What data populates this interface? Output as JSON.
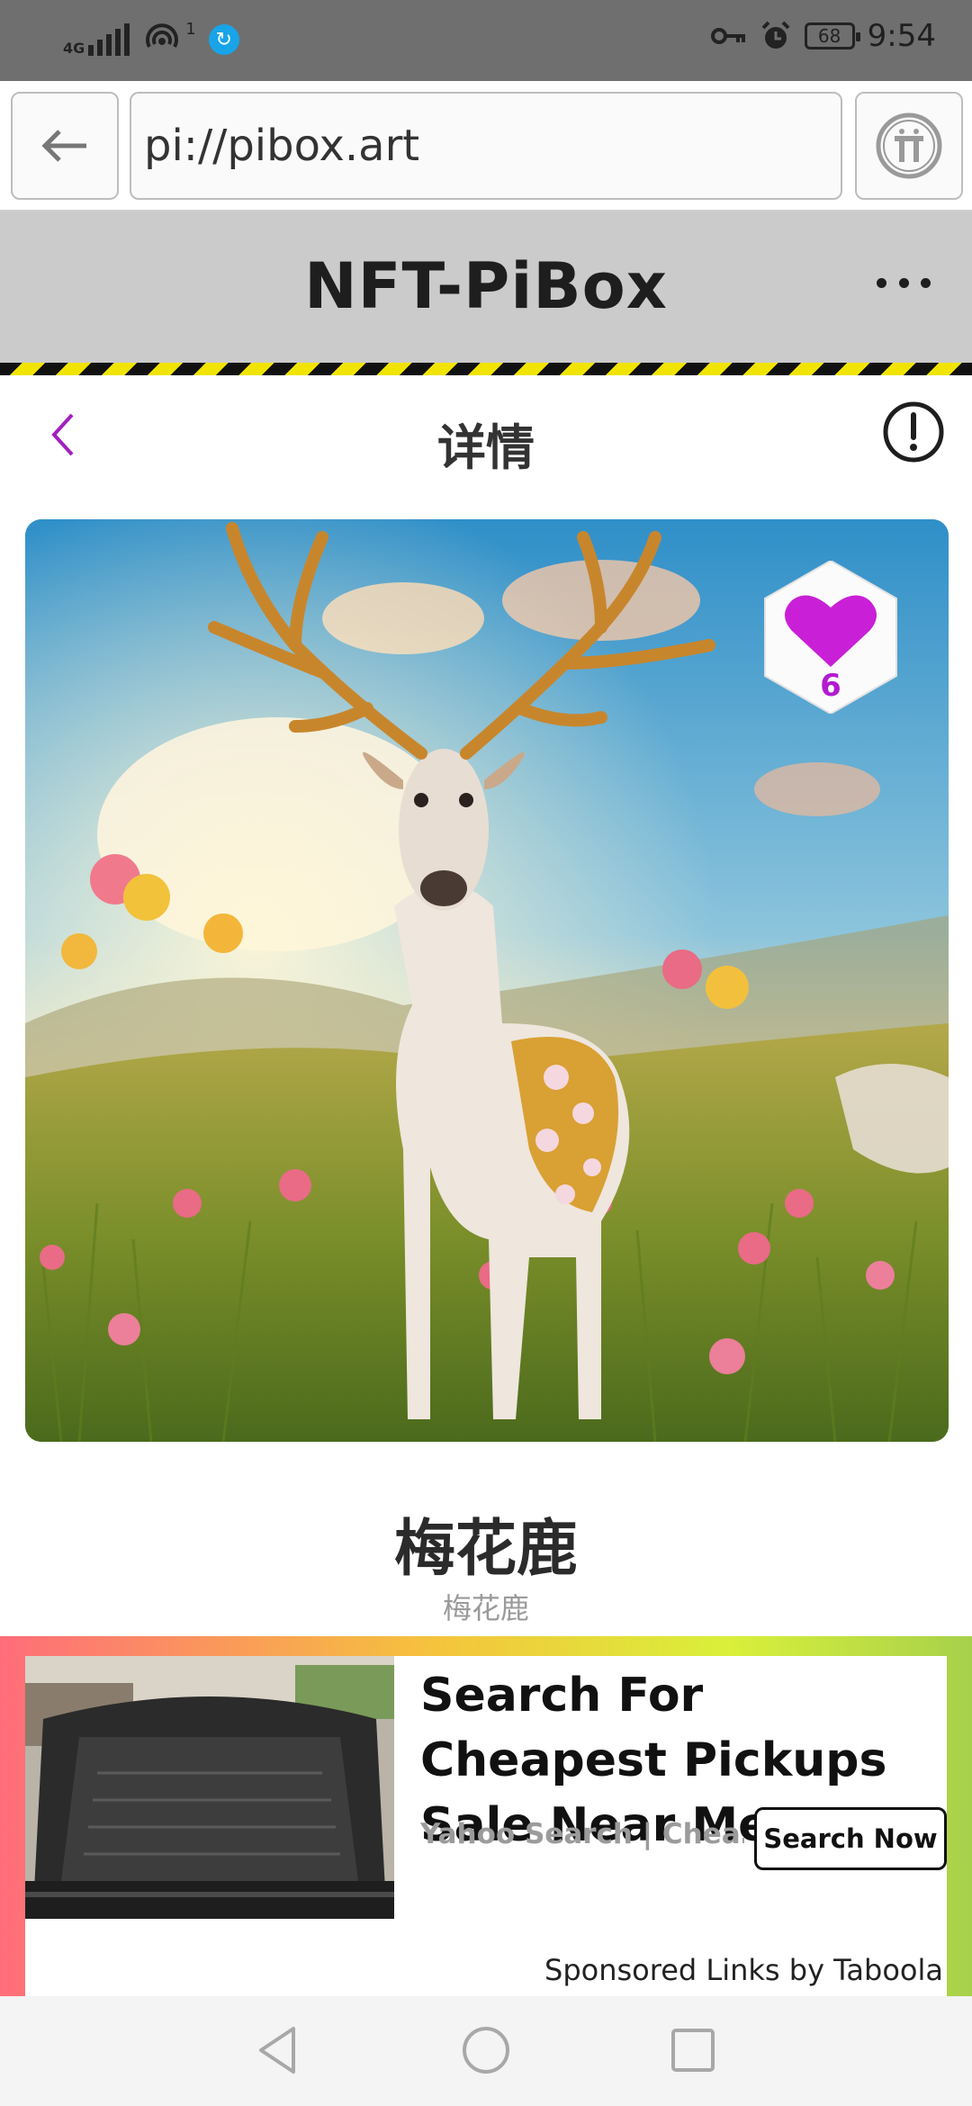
{
  "status_bar": {
    "network": "4G",
    "hotspot_count": "1",
    "battery": "68",
    "time": "9:54",
    "icons": [
      "signal-icon",
      "hotspot-icon",
      "app-notification-icon",
      "vpn-key-icon",
      "alarm-icon",
      "battery-icon"
    ]
  },
  "browser": {
    "url": "pi://pibox.art",
    "back_icon": "arrow-left-icon",
    "pi_icon": "pi-logo-icon"
  },
  "site": {
    "title": "NFT-PiBox",
    "more_icon": "more-horizontal-icon"
  },
  "detail": {
    "title": "详情",
    "back_icon": "chevron-left-icon",
    "info_icon": "exclamation-circle-icon"
  },
  "nft": {
    "image_alt": "deer-artwork",
    "likes": "6",
    "name": "梅花鹿",
    "subtitle": "梅花鹿"
  },
  "ad": {
    "headline": "Search For Cheapest Pickups Sale Near Me",
    "source": "Yahoo Search | Chea…",
    "cta": "Search Now",
    "sponsored": "Sponsored Links by Taboola"
  },
  "colors": {
    "accent": "#b21bd0",
    "header_bg": "#cbcbcb",
    "status_bg": "#6f6f6f",
    "hazard_yellow": "#f1e400"
  },
  "nav": {
    "icons": [
      "nav-back-icon",
      "nav-home-icon",
      "nav-recents-icon"
    ]
  }
}
